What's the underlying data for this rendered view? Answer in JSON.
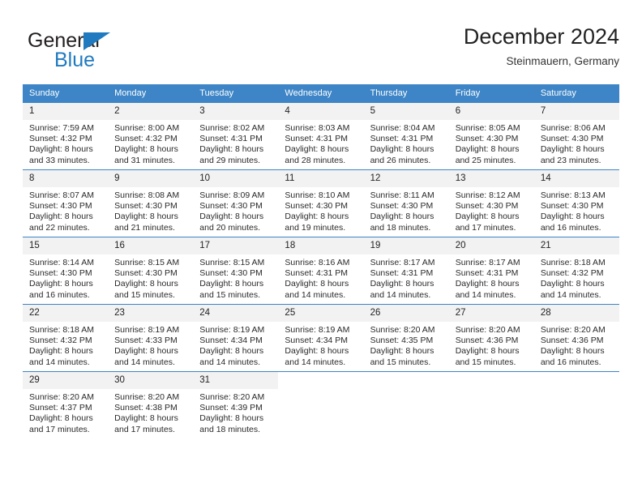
{
  "brand": {
    "name_top": "General",
    "name_bottom": "Blue",
    "triangle_icon": "triangle-logo-icon",
    "color_dark": "#231f20",
    "color_blue": "#1f7ac0"
  },
  "header": {
    "title": "December 2024",
    "location": "Steinmauern, Germany"
  },
  "colors": {
    "header_blue": "#3d85c6",
    "daynum_band": "#f2f2f2",
    "text": "#222222"
  },
  "weekday_headers": [
    "Sunday",
    "Monday",
    "Tuesday",
    "Wednesday",
    "Thursday",
    "Friday",
    "Saturday"
  ],
  "weeks": [
    [
      {
        "day": "1",
        "sunrise": "Sunrise: 7:59 AM",
        "sunset": "Sunset: 4:32 PM",
        "daylight_line1": "Daylight: 8 hours",
        "daylight_line2": "and 33 minutes."
      },
      {
        "day": "2",
        "sunrise": "Sunrise: 8:00 AM",
        "sunset": "Sunset: 4:32 PM",
        "daylight_line1": "Daylight: 8 hours",
        "daylight_line2": "and 31 minutes."
      },
      {
        "day": "3",
        "sunrise": "Sunrise: 8:02 AM",
        "sunset": "Sunset: 4:31 PM",
        "daylight_line1": "Daylight: 8 hours",
        "daylight_line2": "and 29 minutes."
      },
      {
        "day": "4",
        "sunrise": "Sunrise: 8:03 AM",
        "sunset": "Sunset: 4:31 PM",
        "daylight_line1": "Daylight: 8 hours",
        "daylight_line2": "and 28 minutes."
      },
      {
        "day": "5",
        "sunrise": "Sunrise: 8:04 AM",
        "sunset": "Sunset: 4:31 PM",
        "daylight_line1": "Daylight: 8 hours",
        "daylight_line2": "and 26 minutes."
      },
      {
        "day": "6",
        "sunrise": "Sunrise: 8:05 AM",
        "sunset": "Sunset: 4:30 PM",
        "daylight_line1": "Daylight: 8 hours",
        "daylight_line2": "and 25 minutes."
      },
      {
        "day": "7",
        "sunrise": "Sunrise: 8:06 AM",
        "sunset": "Sunset: 4:30 PM",
        "daylight_line1": "Daylight: 8 hours",
        "daylight_line2": "and 23 minutes."
      }
    ],
    [
      {
        "day": "8",
        "sunrise": "Sunrise: 8:07 AM",
        "sunset": "Sunset: 4:30 PM",
        "daylight_line1": "Daylight: 8 hours",
        "daylight_line2": "and 22 minutes."
      },
      {
        "day": "9",
        "sunrise": "Sunrise: 8:08 AM",
        "sunset": "Sunset: 4:30 PM",
        "daylight_line1": "Daylight: 8 hours",
        "daylight_line2": "and 21 minutes."
      },
      {
        "day": "10",
        "sunrise": "Sunrise: 8:09 AM",
        "sunset": "Sunset: 4:30 PM",
        "daylight_line1": "Daylight: 8 hours",
        "daylight_line2": "and 20 minutes."
      },
      {
        "day": "11",
        "sunrise": "Sunrise: 8:10 AM",
        "sunset": "Sunset: 4:30 PM",
        "daylight_line1": "Daylight: 8 hours",
        "daylight_line2": "and 19 minutes."
      },
      {
        "day": "12",
        "sunrise": "Sunrise: 8:11 AM",
        "sunset": "Sunset: 4:30 PM",
        "daylight_line1": "Daylight: 8 hours",
        "daylight_line2": "and 18 minutes."
      },
      {
        "day": "13",
        "sunrise": "Sunrise: 8:12 AM",
        "sunset": "Sunset: 4:30 PM",
        "daylight_line1": "Daylight: 8 hours",
        "daylight_line2": "and 17 minutes."
      },
      {
        "day": "14",
        "sunrise": "Sunrise: 8:13 AM",
        "sunset": "Sunset: 4:30 PM",
        "daylight_line1": "Daylight: 8 hours",
        "daylight_line2": "and 16 minutes."
      }
    ],
    [
      {
        "day": "15",
        "sunrise": "Sunrise: 8:14 AM",
        "sunset": "Sunset: 4:30 PM",
        "daylight_line1": "Daylight: 8 hours",
        "daylight_line2": "and 16 minutes."
      },
      {
        "day": "16",
        "sunrise": "Sunrise: 8:15 AM",
        "sunset": "Sunset: 4:30 PM",
        "daylight_line1": "Daylight: 8 hours",
        "daylight_line2": "and 15 minutes."
      },
      {
        "day": "17",
        "sunrise": "Sunrise: 8:15 AM",
        "sunset": "Sunset: 4:30 PM",
        "daylight_line1": "Daylight: 8 hours",
        "daylight_line2": "and 15 minutes."
      },
      {
        "day": "18",
        "sunrise": "Sunrise: 8:16 AM",
        "sunset": "Sunset: 4:31 PM",
        "daylight_line1": "Daylight: 8 hours",
        "daylight_line2": "and 14 minutes."
      },
      {
        "day": "19",
        "sunrise": "Sunrise: 8:17 AM",
        "sunset": "Sunset: 4:31 PM",
        "daylight_line1": "Daylight: 8 hours",
        "daylight_line2": "and 14 minutes."
      },
      {
        "day": "20",
        "sunrise": "Sunrise: 8:17 AM",
        "sunset": "Sunset: 4:31 PM",
        "daylight_line1": "Daylight: 8 hours",
        "daylight_line2": "and 14 minutes."
      },
      {
        "day": "21",
        "sunrise": "Sunrise: 8:18 AM",
        "sunset": "Sunset: 4:32 PM",
        "daylight_line1": "Daylight: 8 hours",
        "daylight_line2": "and 14 minutes."
      }
    ],
    [
      {
        "day": "22",
        "sunrise": "Sunrise: 8:18 AM",
        "sunset": "Sunset: 4:32 PM",
        "daylight_line1": "Daylight: 8 hours",
        "daylight_line2": "and 14 minutes."
      },
      {
        "day": "23",
        "sunrise": "Sunrise: 8:19 AM",
        "sunset": "Sunset: 4:33 PM",
        "daylight_line1": "Daylight: 8 hours",
        "daylight_line2": "and 14 minutes."
      },
      {
        "day": "24",
        "sunrise": "Sunrise: 8:19 AM",
        "sunset": "Sunset: 4:34 PM",
        "daylight_line1": "Daylight: 8 hours",
        "daylight_line2": "and 14 minutes."
      },
      {
        "day": "25",
        "sunrise": "Sunrise: 8:19 AM",
        "sunset": "Sunset: 4:34 PM",
        "daylight_line1": "Daylight: 8 hours",
        "daylight_line2": "and 14 minutes."
      },
      {
        "day": "26",
        "sunrise": "Sunrise: 8:20 AM",
        "sunset": "Sunset: 4:35 PM",
        "daylight_line1": "Daylight: 8 hours",
        "daylight_line2": "and 15 minutes."
      },
      {
        "day": "27",
        "sunrise": "Sunrise: 8:20 AM",
        "sunset": "Sunset: 4:36 PM",
        "daylight_line1": "Daylight: 8 hours",
        "daylight_line2": "and 15 minutes."
      },
      {
        "day": "28",
        "sunrise": "Sunrise: 8:20 AM",
        "sunset": "Sunset: 4:36 PM",
        "daylight_line1": "Daylight: 8 hours",
        "daylight_line2": "and 16 minutes."
      }
    ],
    [
      {
        "day": "29",
        "sunrise": "Sunrise: 8:20 AM",
        "sunset": "Sunset: 4:37 PM",
        "daylight_line1": "Daylight: 8 hours",
        "daylight_line2": "and 17 minutes."
      },
      {
        "day": "30",
        "sunrise": "Sunrise: 8:20 AM",
        "sunset": "Sunset: 4:38 PM",
        "daylight_line1": "Daylight: 8 hours",
        "daylight_line2": "and 17 minutes."
      },
      {
        "day": "31",
        "sunrise": "Sunrise: 8:20 AM",
        "sunset": "Sunset: 4:39 PM",
        "daylight_line1": "Daylight: 8 hours",
        "daylight_line2": "and 18 minutes."
      },
      null,
      null,
      null,
      null
    ]
  ]
}
